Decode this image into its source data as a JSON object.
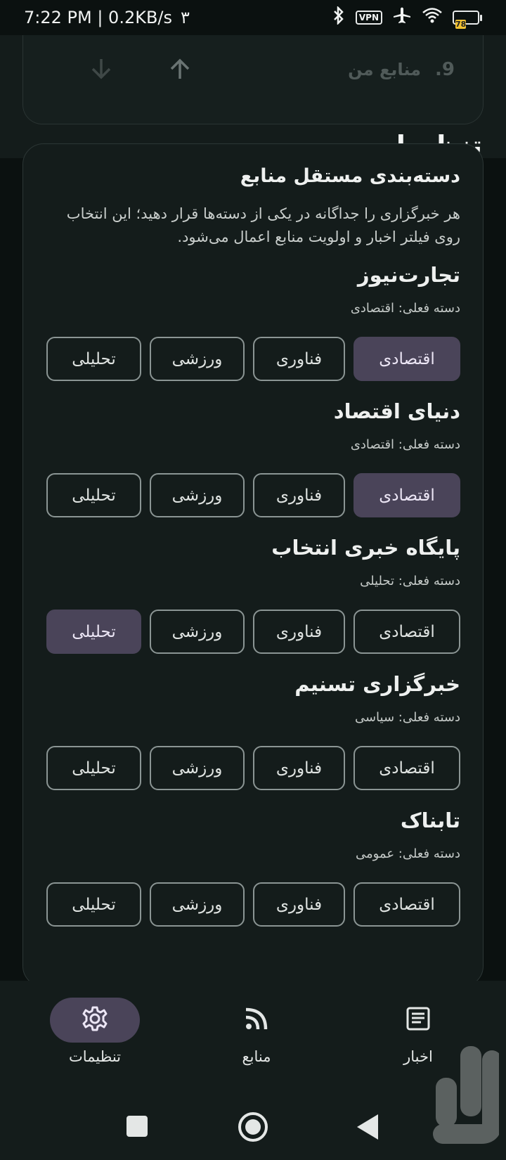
{
  "status": {
    "time": "7:22 PM | 0.2KB/s",
    "extra": "۳",
    "vpn": "VPN",
    "battery": "78"
  },
  "prev_item": {
    "number": "9.",
    "label": "منابع من"
  },
  "page": {
    "title": "تنظیمات"
  },
  "card": {
    "title": "دسته‌بندی مستقل منابع",
    "description": "هر خبرگزاری را جداگانه در یکی از دسته‌ها قرار دهید؛ این انتخاب روی فیلتر اخبار و اولویت منابع اعمال می‌شود."
  },
  "categories": [
    "اقتصادی",
    "فناوری",
    "ورزشی",
    "تحلیلی"
  ],
  "sources": [
    {
      "name": "تجارت‌نیوز",
      "current": "دسته فعلی: اقتصادی",
      "selected": 0
    },
    {
      "name": "دنیای اقتصاد",
      "current": "دسته فعلی: اقتصادی",
      "selected": 0
    },
    {
      "name": "پایگاه خبری انتخاب",
      "current": "دسته فعلی: تحلیلی",
      "selected": 3
    },
    {
      "name": "خبرگزاری تسنیم",
      "current": "دسته فعلی: سیاسی",
      "selected": -1
    },
    {
      "name": "تابناک",
      "current": "دسته فعلی: عمومی",
      "selected": -1
    }
  ],
  "nav": {
    "settings": "تنظیمات",
    "sources": "منابع",
    "news": "اخبار"
  },
  "colors": {
    "selected_chip": "#4a4459",
    "background": "#141c1b"
  }
}
